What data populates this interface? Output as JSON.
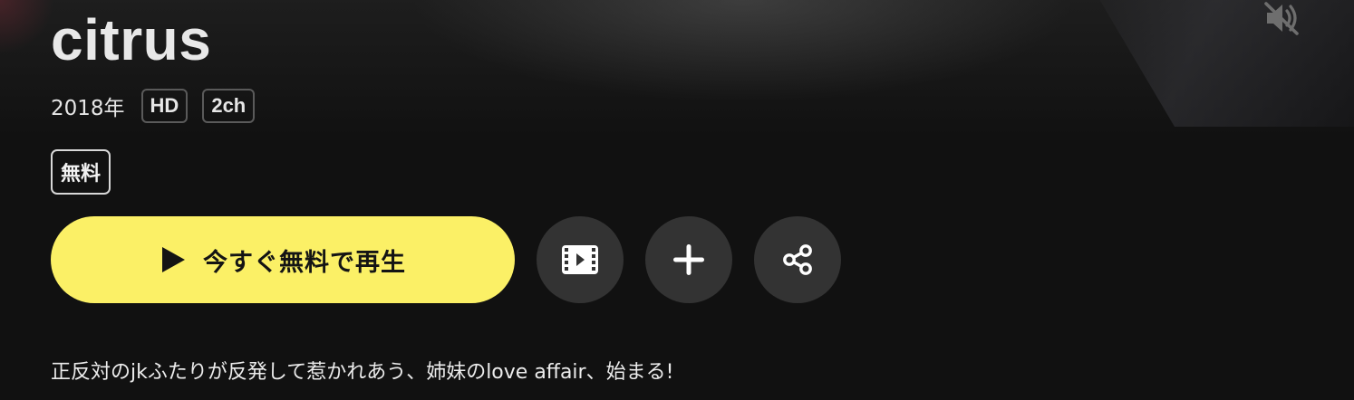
{
  "title": "citrus",
  "meta": {
    "year": "2018年",
    "badges": [
      "HD",
      "2ch"
    ]
  },
  "price_badge": "無料",
  "actions": {
    "play_label": "今すぐ無料で再生",
    "play_icon": "play-icon",
    "trailer_icon": "film-icon",
    "add_icon": "plus-icon",
    "share_icon": "share-icon",
    "mute_icon": "muted-speaker-icon"
  },
  "description": "正反対のjkふたりが反発して惹かれあう、姉妹のlove affair、始まる!",
  "colors": {
    "background": "#111111",
    "play_button": "#fbf066",
    "circle_button": "#333333"
  }
}
